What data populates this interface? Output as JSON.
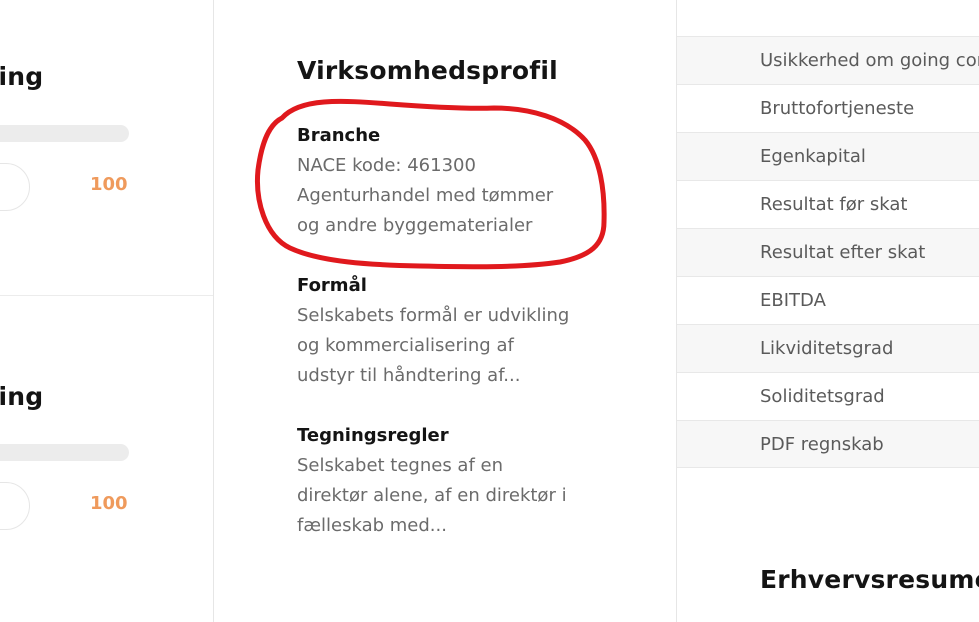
{
  "left": {
    "cards": [
      {
        "title_fragment": "ring",
        "score": "100"
      },
      {
        "title_fragment": "ring",
        "score": "100"
      }
    ]
  },
  "profile": {
    "title": "Virksomhedsprofil",
    "branche": {
      "label": "Branche",
      "lines": [
        "NACE kode: 461300",
        "Agenturhandel med tømmer",
        "og andre byggematerialer"
      ]
    },
    "formaal": {
      "label": "Formål",
      "lines": [
        "Selskabets formål er udvikling",
        "og kommercialisering af",
        "udstyr til håndtering af..."
      ]
    },
    "tegningsregler": {
      "label": "Tegningsregler",
      "lines": [
        "Selskabet tegnes af en",
        "direktør alene, af en direktør i",
        "fælleskab med..."
      ]
    },
    "annotation_color": "#e0191d"
  },
  "kpis": {
    "rows": [
      "Usikkerhed om going concern",
      "Bruttofortjeneste",
      "Egenkapital",
      "Resultat før skat",
      "Resultat efter skat",
      "EBITDA",
      "Likviditetsgrad",
      "Soliditetsgrad",
      "PDF regnskab"
    ]
  },
  "erhvervsresume": {
    "title": "Erhvervsresumé"
  }
}
